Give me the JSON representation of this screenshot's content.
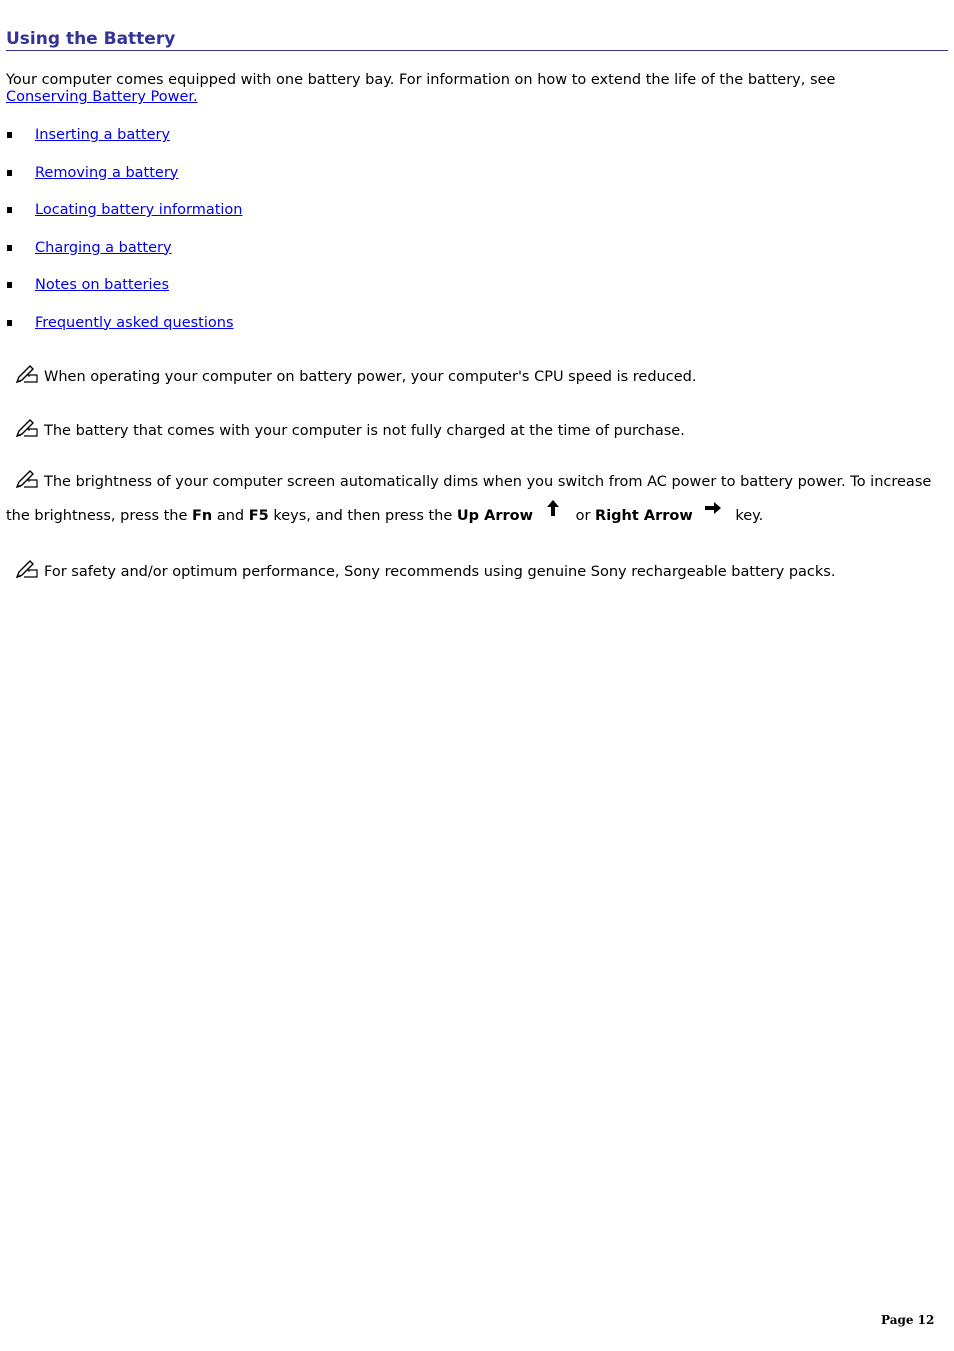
{
  "page": {
    "title": "Using the Battery",
    "intro": {
      "text": "Your computer comes equipped with one battery bay. For information on how to extend the life of the battery, see ",
      "link": "Conserving Battery Power."
    },
    "links": [
      {
        "label": "Inserting a battery"
      },
      {
        "label": "Removing a battery"
      },
      {
        "label": "Locating battery information"
      },
      {
        "label": "Charging a battery"
      },
      {
        "label": "Notes on batteries"
      },
      {
        "label": "Frequently asked questions"
      }
    ],
    "notes": {
      "note1": "When operating your computer on battery power, your computer's CPU speed is reduced.",
      "note2": "The battery that comes with your computer is not fully charged at the time of purchase.",
      "note3": {
        "part1": "The brightness of your computer screen automatically dims when you switch from AC power to battery power. To increase the brightness, press the ",
        "key1": "Fn",
        "part2": " and ",
        "key2": "F5",
        "part3": " keys, and then press the ",
        "key3": "Up Arrow",
        "part4": " or ",
        "key4": "Right Arrow",
        "part5": " key."
      },
      "note4": "For safety and/or optimum performance, Sony recommends using genuine Sony rechargeable battery packs."
    },
    "footer": {
      "page_number": "Page 12"
    }
  }
}
